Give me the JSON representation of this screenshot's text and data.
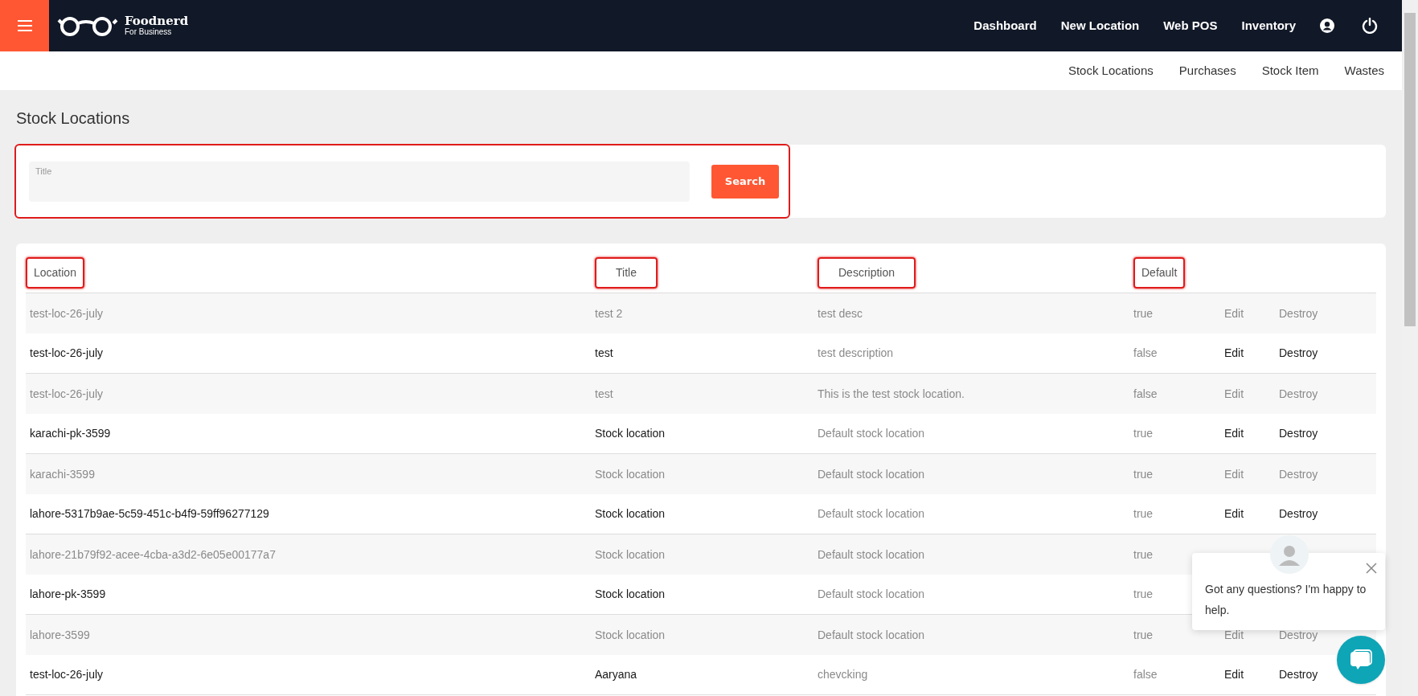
{
  "brand": {
    "name": "Foodnerd",
    "tagline": "For Business"
  },
  "top_nav": [
    "Dashboard",
    "New Location",
    "Web POS",
    "Inventory"
  ],
  "sub_nav": [
    "Stock Locations",
    "Purchases",
    "Stock Item",
    "Wastes"
  ],
  "page_title": "Stock Locations",
  "search": {
    "placeholder": "Title",
    "button": "Search",
    "highlighted": true
  },
  "table": {
    "columns": [
      {
        "label": "Location",
        "highlighted": true
      },
      {
        "label": "Title",
        "highlighted": true
      },
      {
        "label": "Description",
        "highlighted": true
      },
      {
        "label": "Default",
        "highlighted": true
      }
    ],
    "rows": [
      {
        "location": "test-loc-26-july",
        "title": "test 2",
        "description": "test desc",
        "default": "true",
        "actions": [
          "Edit",
          "Destroy"
        ]
      },
      {
        "location": "test-loc-26-july",
        "title": "test",
        "description": "test description",
        "default": "false",
        "actions": [
          "Edit",
          "Destroy"
        ]
      },
      {
        "location": "test-loc-26-july",
        "title": "test",
        "description": "This is the test stock location.",
        "default": "false",
        "actions": [
          "Edit",
          "Destroy"
        ]
      },
      {
        "location": "karachi-pk-3599",
        "title": "Stock location",
        "description": "Default stock location",
        "default": "true",
        "actions": [
          "Edit",
          "Destroy"
        ]
      },
      {
        "location": "karachi-3599",
        "title": "Stock location",
        "description": "Default stock location",
        "default": "true",
        "actions": [
          "Edit",
          "Destroy"
        ]
      },
      {
        "location": "lahore-5317b9ae-5c59-451c-b4f9-59ff96277129",
        "title": "Stock location",
        "description": "Default stock location",
        "default": "true",
        "actions": [
          "Edit",
          "Destroy"
        ]
      },
      {
        "location": "lahore-21b79f92-acee-4cba-a3d2-6e05e00177a7",
        "title": "Stock location",
        "description": "Default stock location",
        "default": "true"
      },
      {
        "location": "lahore-pk-3599",
        "title": "Stock location",
        "description": "Default stock location",
        "default": "true"
      },
      {
        "location": "lahore-3599",
        "title": "Stock location",
        "description": "Default stock location",
        "default": "true",
        "actions": [
          "Edit",
          "Destroy"
        ]
      },
      {
        "location": "test-loc-26-july",
        "title": "Aaryana",
        "description": "chevcking",
        "default": "false",
        "actions": [
          "Edit",
          "Destroy"
        ]
      }
    ]
  },
  "chat_popup": {
    "message": "Got any questions? I'm happy to help."
  }
}
